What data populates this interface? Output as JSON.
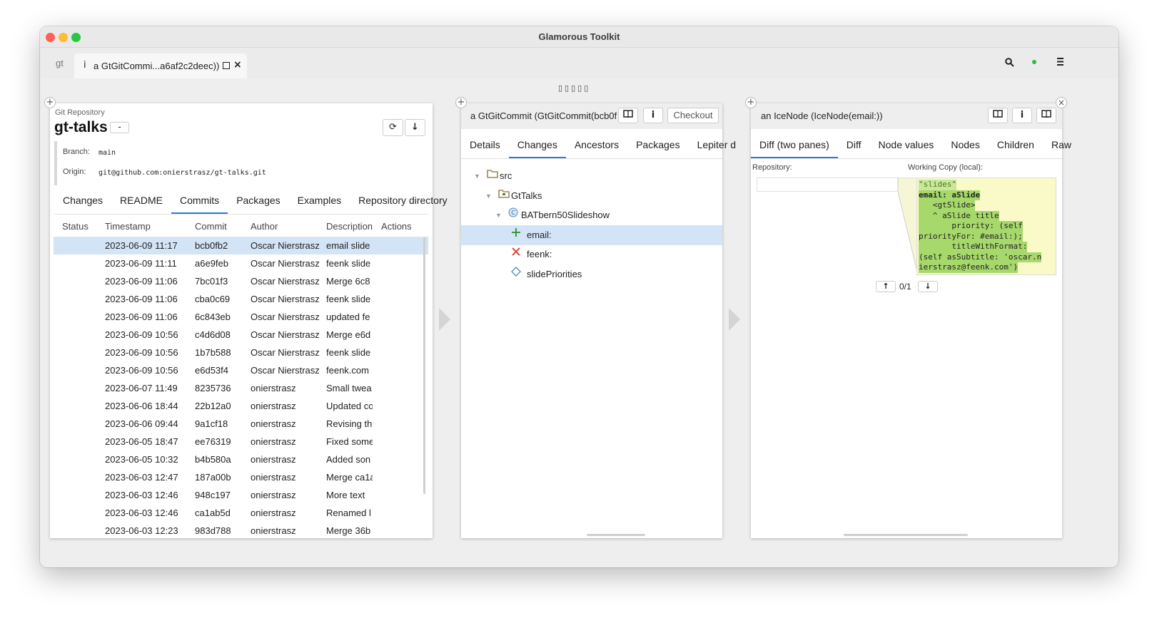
{
  "window": {
    "title": "Glamorous Toolkit"
  },
  "tabbar": {
    "gt_label": "gt",
    "tab_title": "a GtGitCommi...a6af2c2deec))",
    "status_color": "#2dbd3a"
  },
  "pane1": {
    "subtitle": "Git Repository",
    "title": "gt-talks",
    "collapse_label": "-",
    "branch_label": "Branch:",
    "branch_value": "main",
    "origin_label": "Origin:",
    "origin_value": "git@github.com:onierstrasz/gt-talks.git",
    "tabs": [
      "Changes",
      "README",
      "Commits",
      "Packages",
      "Examples",
      "Repository directory"
    ],
    "active_tab": "Commits",
    "columns": [
      "Status",
      "Timestamp",
      "Commit",
      "Author",
      "Description",
      "Actions"
    ],
    "rows": [
      {
        "timestamp": "2023-06-09 11:17",
        "commit": "bcb0fb2",
        "author": "Oscar Nierstrasz",
        "description": "email slide"
      },
      {
        "timestamp": "2023-06-09 11:11",
        "commit": "a6e9feb",
        "author": "Oscar Nierstrasz",
        "description": "feenk slide"
      },
      {
        "timestamp": "2023-06-09 11:06",
        "commit": "7bc01f3",
        "author": "Oscar Nierstrasz",
        "description": "Merge 6c8"
      },
      {
        "timestamp": "2023-06-09 11:06",
        "commit": "cba0c69",
        "author": "Oscar Nierstrasz",
        "description": "feenk slide"
      },
      {
        "timestamp": "2023-06-09 11:06",
        "commit": "6c843eb",
        "author": "Oscar Nierstrasz",
        "description": "updated fe"
      },
      {
        "timestamp": "2023-06-09 10:56",
        "commit": "c4d6d08",
        "author": "Oscar Nierstrasz",
        "description": "Merge e6d"
      },
      {
        "timestamp": "2023-06-09 10:56",
        "commit": "1b7b588",
        "author": "Oscar Nierstrasz",
        "description": "feenk slide"
      },
      {
        "timestamp": "2023-06-09 10:56",
        "commit": "e6d53f4",
        "author": "Oscar Nierstrasz",
        "description": "feenk.com"
      },
      {
        "timestamp": "2023-06-07 11:49",
        "commit": "8235736",
        "author": "onierstrasz",
        "description": "Small twea"
      },
      {
        "timestamp": "2023-06-06 18:44",
        "commit": "22b12a0",
        "author": "onierstrasz",
        "description": "Updated co"
      },
      {
        "timestamp": "2023-06-06 09:44",
        "commit": "9a1cf18",
        "author": "onierstrasz",
        "description": "Revising th"
      },
      {
        "timestamp": "2023-06-05 18:47",
        "commit": "ee76319",
        "author": "onierstrasz",
        "description": "Fixed some"
      },
      {
        "timestamp": "2023-06-05 10:32",
        "commit": "b4b580a",
        "author": "onierstrasz",
        "description": "Added son"
      },
      {
        "timestamp": "2023-06-03 12:47",
        "commit": "187a00b",
        "author": "onierstrasz",
        "description": "Merge ca1a"
      },
      {
        "timestamp": "2023-06-03 12:46",
        "commit": "948c197",
        "author": "onierstrasz",
        "description": "More text"
      },
      {
        "timestamp": "2023-06-03 12:46",
        "commit": "ca1ab5d",
        "author": "onierstrasz",
        "description": "Renamed l"
      },
      {
        "timestamp": "2023-06-03 12:23",
        "commit": "983d788",
        "author": "onierstrasz",
        "description": "Merge 36b"
      }
    ]
  },
  "pane2": {
    "title": "a GtGitCommit (GtGitCommit(bcb0f",
    "checkout_label": "Checkout",
    "tabs": [
      "Details",
      "Changes",
      "Ancestors",
      "Packages",
      "Lepiter d"
    ],
    "active_tab": "Changes",
    "tree": [
      {
        "label": "src",
        "icon": "folder-icon"
      },
      {
        "label": "GtTalks",
        "icon": "package-folder-icon"
      },
      {
        "label": "BATbern50Slideshow",
        "icon": "class-icon"
      },
      {
        "label": "email:",
        "icon": "plus-icon"
      },
      {
        "label": "feenk:",
        "icon": "cross-icon"
      },
      {
        "label": "slidePriorities",
        "icon": "diamond-icon"
      }
    ]
  },
  "pane3": {
    "title": "an IceNode (IceNode(email:))",
    "tabs": [
      "Diff (two panes)",
      "Diff",
      "Node values",
      "Nodes",
      "Children",
      "Raw"
    ],
    "active_tab": "Diff (two panes)",
    "repo_label": "Repository:",
    "working_label": "Working Copy (local):",
    "counter": "0/1",
    "code_lines": [
      "\"slides\"",
      "email: aSlide",
      "   <gtSlide>",
      "   ^ aSlide title",
      "       priority: (self",
      "priorityFor: #email:);",
      "       titleWithFormat:",
      "(self asSubtitle: 'oscar.n",
      "ierstrasz@feenk.com')"
    ]
  }
}
